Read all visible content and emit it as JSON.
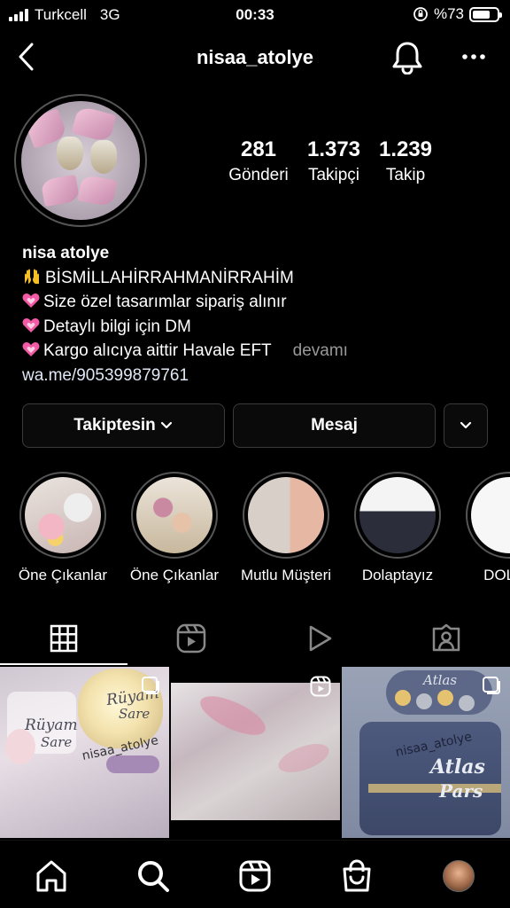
{
  "status_bar": {
    "carrier": "Turkcell",
    "network": "3G",
    "time": "00:33",
    "battery": "%73",
    "battery_level": 0.73
  },
  "nav": {
    "title": "nisaa_atolye"
  },
  "profile": {
    "stats": [
      {
        "value": "281",
        "label": "Gönderi"
      },
      {
        "value": "1.373",
        "label": "Takipçi"
      },
      {
        "value": "1.239",
        "label": "Takip"
      }
    ],
    "name": "nisa atolye",
    "bio_lines": [
      "BİSMİLLAHİRRAHMANİRRAHİM",
      "Size özel tasarımlar sipariş alınır",
      "Detaylı bilgi için DM",
      "Kargo alıcıya aittir Havale EFT"
    ],
    "more": "devamı",
    "link": "wa.me/905399879761"
  },
  "actions": {
    "follow": "Takiptesin",
    "message": "Mesaj"
  },
  "highlights": [
    {
      "label": "Öne Çıkanlar"
    },
    {
      "label": "Öne Çıkanlar"
    },
    {
      "label": "Mutlu Müşteri"
    },
    {
      "label": "Dolaptayız"
    },
    {
      "label": "DOLAP"
    }
  ],
  "tabs": [
    {
      "icon": "grid-icon"
    },
    {
      "icon": "reels-icon"
    },
    {
      "icon": "video-play-icon"
    },
    {
      "icon": "tagged-icon"
    }
  ],
  "posts": [
    {
      "text1": "Rüyam",
      "text2": "Sare",
      "watermark": "nisaa_atolye",
      "badge": "carousel-icon"
    },
    {
      "badge": "reels-icon"
    },
    {
      "text1": "Atlas",
      "text2": "Pars",
      "watermark": "nisaa_atolye",
      "badge": "carousel-icon"
    }
  ],
  "bottom_nav": [
    {
      "icon": "home-icon"
    },
    {
      "icon": "search-icon"
    },
    {
      "icon": "reels-icon"
    },
    {
      "icon": "shop-icon"
    },
    {
      "icon": "profile-avatar"
    }
  ]
}
